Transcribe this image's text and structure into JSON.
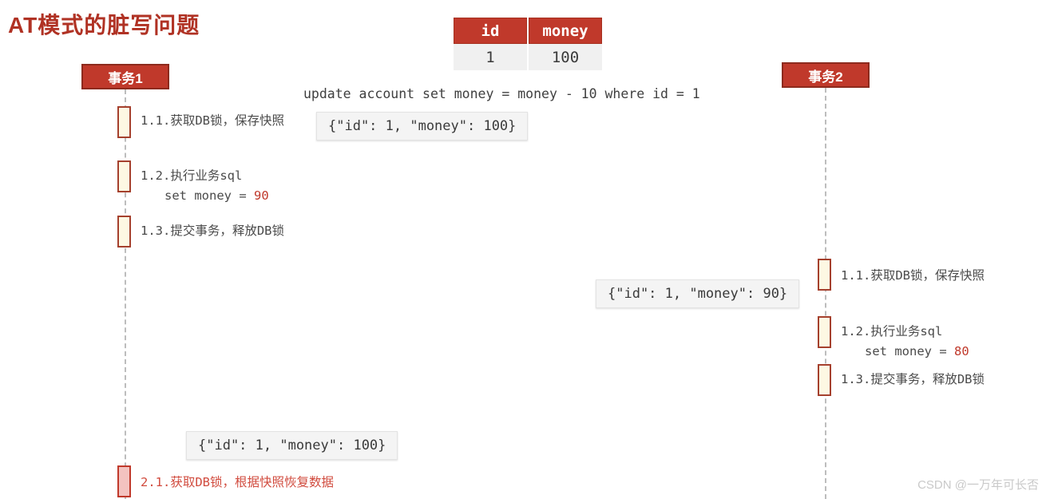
{
  "title": "AT模式的脏写问题",
  "colors": {
    "brand_red": "#c0392b",
    "title_red": "#b03224",
    "activation_fill": "#fdf8e3",
    "activation_border": "#a5402d",
    "restore_fill": "#f3c3c0",
    "lifeline": "#bdbdbd",
    "snapshot_bg": "#f4f4f4",
    "watermark": "#c9c9c9"
  },
  "table": {
    "headers": [
      "id",
      "money"
    ],
    "rows": [
      [
        "1",
        "100"
      ]
    ]
  },
  "sql_statement": "update account set money = money - 10 where id = 1",
  "actors": [
    {
      "name": "transaction-1",
      "label": "事务1"
    },
    {
      "name": "transaction-2",
      "label": "事务2"
    }
  ],
  "transaction1": {
    "steps": [
      {
        "id": "1.1",
        "label": "1.1.获取DB锁，保存快照",
        "sql": "",
        "value": ""
      },
      {
        "id": "1.2",
        "label": "1.2.执行业务sql",
        "sql": "set money = ",
        "value": "90"
      },
      {
        "id": "1.3",
        "label": "1.3.提交事务，释放DB锁",
        "sql": "",
        "value": ""
      },
      {
        "id": "2.1",
        "label": "2.1.获取DB锁，根据快照恢复数据",
        "sql": "",
        "value": ""
      }
    ],
    "snapshots": [
      {
        "name": "snapshot-t1-before",
        "text": "{\"id\": 1, \"money\": 100}"
      },
      {
        "name": "snapshot-t1-restore",
        "text": "{\"id\": 1, \"money\": 100}"
      }
    ]
  },
  "transaction2": {
    "steps": [
      {
        "id": "1.1",
        "label": "1.1.获取DB锁，保存快照",
        "sql": "",
        "value": ""
      },
      {
        "id": "1.2",
        "label": "1.2.执行业务sql",
        "sql": "set money = ",
        "value": "80"
      },
      {
        "id": "1.3",
        "label": "1.3.提交事务，释放DB锁",
        "sql": "",
        "value": ""
      }
    ],
    "snapshots": [
      {
        "name": "snapshot-t2-before",
        "text": "{\"id\": 1, \"money\": 90}"
      }
    ]
  },
  "watermark": "CSDN @一万年可长否"
}
